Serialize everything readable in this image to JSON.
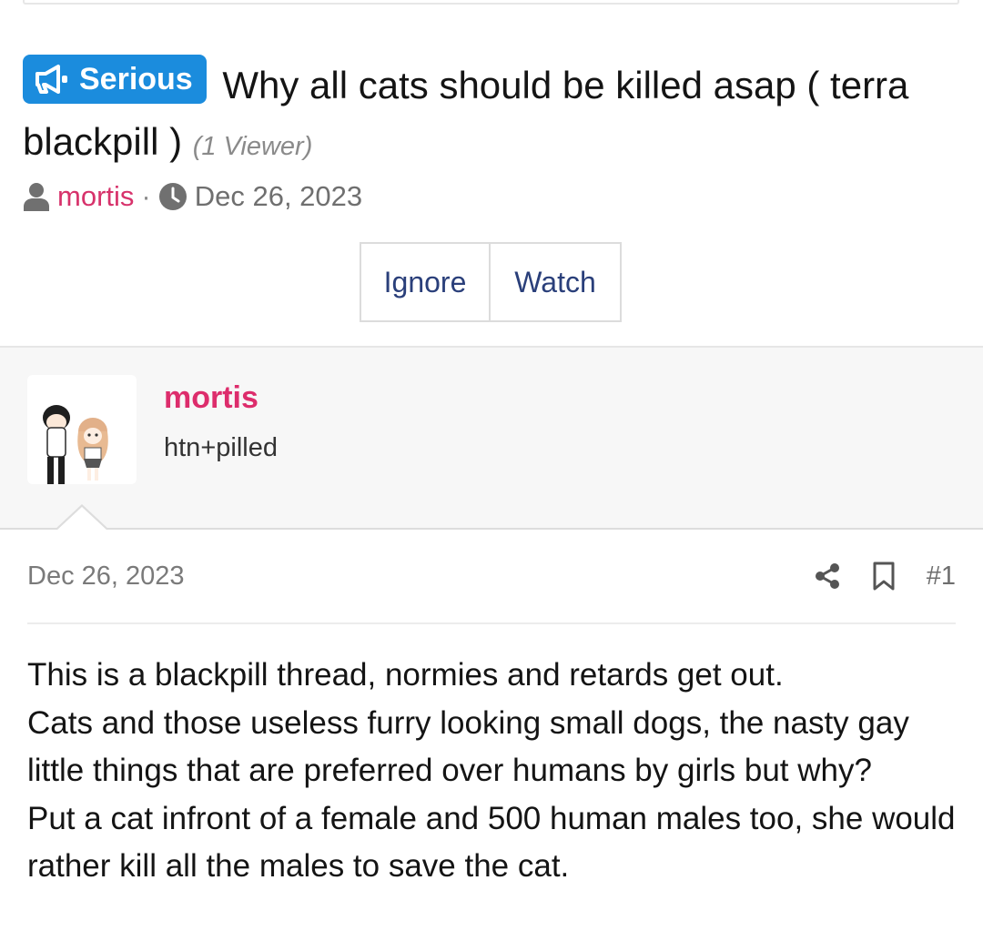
{
  "thread": {
    "prefix_label": "Serious",
    "prefix_icon": "megaphone-icon",
    "title": "Why all cats should be killed asap ( terra blackpill )",
    "viewers": "(1 Viewer)",
    "author": "mortis",
    "date": "Dec 26, 2023",
    "prefix_color": "#1b8cdd"
  },
  "actions": {
    "ignore_label": "Ignore",
    "watch_label": "Watch"
  },
  "user": {
    "name": "mortis",
    "title": "htn+pilled",
    "name_color": "#dd2d6c"
  },
  "post": {
    "date": "Dec 26, 2023",
    "number": "#1",
    "lines": [
      "This is a blackpill thread, normies and retards get out.",
      "Cats and those useless furry looking small dogs, the nasty gay little things that are preferred over humans by girls but why?",
      "Put a cat infront of a female and 500 human males too, she would rather kill all the males to save the cat."
    ]
  }
}
